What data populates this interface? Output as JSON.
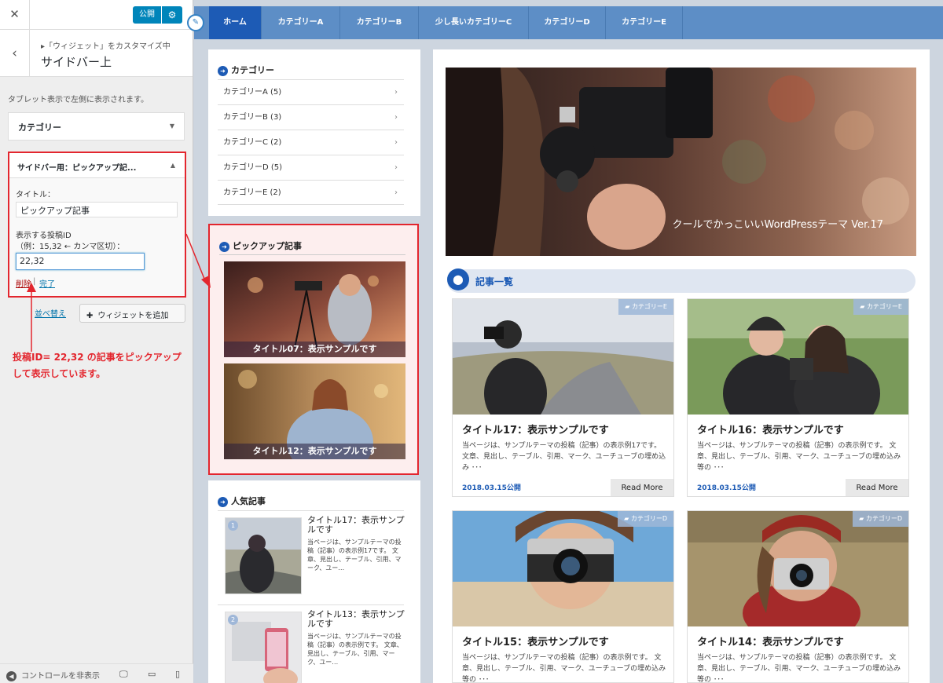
{
  "customizer": {
    "close_icon": "close-icon",
    "publish_label": "公開",
    "breadcrumb": "▸「ウィジェット」をカスタマイズ中",
    "section_title": "サイドバー上",
    "description": "タブレット表示で左側に表示されます。",
    "widget_category_label": "カテゴリー",
    "widget_pickup": {
      "header": "サイドバー用：ピックアップ記...",
      "title_label": "タイトル：",
      "title_value": "ピックアップ記事",
      "ids_label_1": "表示する投稿ID",
      "ids_label_2": "（例：15,32 ← カンマ区切）：",
      "ids_value": "22,32",
      "delete_label": "削除",
      "separator": "|",
      "done_label": "完了"
    },
    "reorder_label": "並べ替え",
    "add_widget_label": "ウィジェットを追加",
    "annotation_line1": "投稿ID= 22,32 の記事をピックアップ",
    "annotation_line2": "して表示しています。",
    "footer_hide_label": "コントロールを非表示"
  },
  "nav": {
    "items": [
      "ホーム",
      "カテゴリーA",
      "カテゴリーB",
      "少し長いカテゴリーC",
      "カテゴリーD",
      "カテゴリーE"
    ],
    "active_color": "#1d5bb5",
    "bar_color": "#5d8ec6"
  },
  "sidebar": {
    "category_title": "カテゴリー",
    "categories": [
      "カテゴリーA (5)",
      "カテゴリーB (3)",
      "カテゴリーC (2)",
      "カテゴリーD (5)",
      "カテゴリーE (2)"
    ],
    "pickup_title": "ピックアップ記事",
    "pickup_items": [
      "タイトル07：表示サンプルです",
      "タイトル12：表示サンプルです"
    ],
    "popular_title": "人気記事",
    "popular": [
      {
        "rank": "1",
        "title": "タイトル17：表示サンプルです",
        "excerpt": "当ページは、サンプルテーマの投稿（記事）の表示例17です。 文章、見出し、テーブル、引用、マーク、ユー…"
      },
      {
        "rank": "2",
        "title": "タイトル13：表示サンプルです",
        "excerpt": "当ページは、サンプルテーマの投稿（記事）の表示例です。 文章、見出し、テーブル、引用、マーク、ユー…"
      }
    ]
  },
  "main": {
    "hero_caption": "クールでかっこいいWordPressテーマ Ver.17",
    "list_title": "記事一覧",
    "cards": [
      {
        "category": "カテゴリーE",
        "title": "タイトル17：表示サンプルです",
        "excerpt": "当ページは、サンプルテーマの投稿（記事）の表示例17です。 文章、見出し、テーブル、引用、マーク、ユーチューブの埋め込み ･･･",
        "date": "2018.03.15公開",
        "more": "Read More"
      },
      {
        "category": "カテゴリーE",
        "title": "タイトル16：表示サンプルです",
        "excerpt": "当ページは、サンプルテーマの投稿（記事）の表示例です。 文章、見出し、テーブル、引用、マーク、ユーチューブの埋め込み等の ･･･",
        "date": "2018.03.15公開",
        "more": "Read More"
      },
      {
        "category": "カテゴリーD",
        "title": "タイトル15：表示サンプルです",
        "excerpt": "当ページは、サンプルテーマの投稿（記事）の表示例です。 文章、見出し、テーブル、引用、マーク、ユーチューブの埋め込み等の ･･･",
        "date": "",
        "more": ""
      },
      {
        "category": "カテゴリーD",
        "title": "タイトル14：表示サンプルです",
        "excerpt": "当ページは、サンプルテーマの投稿（記事）の表示例です。 文章、見出し、テーブル、引用、マーク、ユーチューブの埋め込み等の ･･･",
        "date": "",
        "more": ""
      }
    ]
  }
}
